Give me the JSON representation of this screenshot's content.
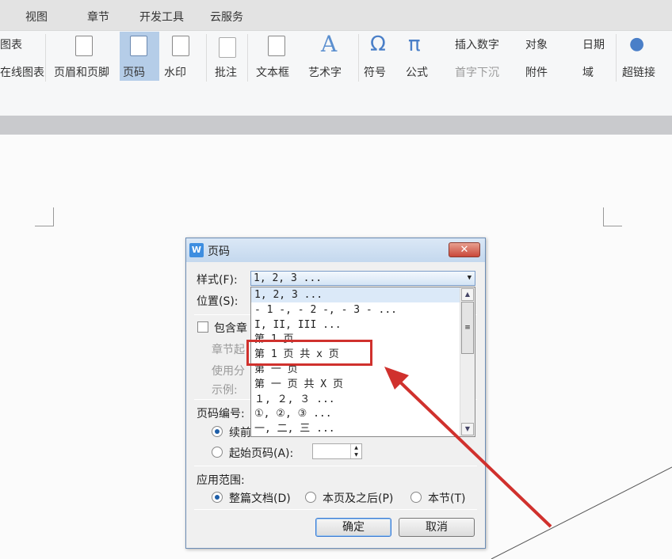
{
  "tabs": [
    "视图",
    "章节",
    "开发工具",
    "云服务"
  ],
  "ribbon": {
    "chart": "图表",
    "online_chart": "在线图表",
    "header_footer": "页眉和页脚",
    "page_number": "页码",
    "watermark": "水印",
    "comment": "批注",
    "textbox": "文本框",
    "wordart": "艺术字",
    "symbol": "符号",
    "formula": "公式",
    "insert_number": "插入数字",
    "object": "对象",
    "date": "日期",
    "dropcap": "首字下沉",
    "attachment": "附件",
    "field": "域",
    "hyperlink": "超链接"
  },
  "dialog": {
    "title": "页码",
    "close": "✕",
    "style_label": "样式(F):",
    "style_value": "1, 2, 3 ...",
    "position_label": "位置(S):",
    "include_chapter": "包含章",
    "chapter_start": "章节起",
    "use_sep": "使用分",
    "example": "示例:",
    "numbering_label": "页码编号:",
    "continue": "续前",
    "start_at": "起始页码(A):",
    "scope_label": "应用范围:",
    "scope_whole": "整篇文档(D)",
    "scope_after": "本页及之后(P)",
    "scope_section": "本节(T)",
    "ok": "确定",
    "cancel": "取消",
    "options": [
      "1, 2, 3 ...",
      "- 1 -, - 2 -, - 3 - ...",
      "I, II, III ...",
      "第 1 页",
      "第 1 页 共 x 页",
      "第 一 页",
      "第 一 页 共 X 页",
      "１, ２, ３ ...",
      "①, ②, ③ ...",
      "一, 二, 三 ..."
    ]
  },
  "colors": {
    "highlight": "#d0312d",
    "accent": "#b5cde8"
  }
}
